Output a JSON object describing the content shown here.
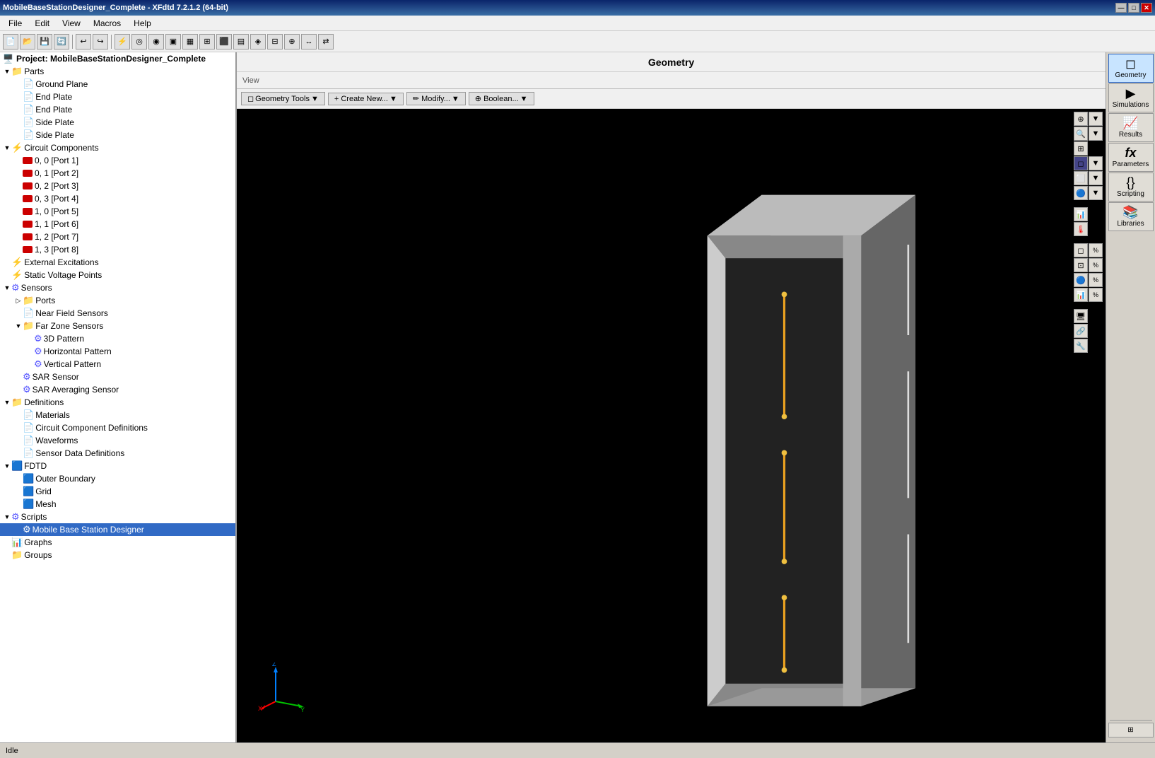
{
  "titlebar": {
    "title": "MobileBaseStationDesigner_Complete - XFdtd 7.2.1.2 (64-bit)",
    "controls": [
      "—",
      "□",
      "✕"
    ]
  },
  "menu": {
    "items": [
      "File",
      "Edit",
      "View",
      "Macros",
      "Help"
    ]
  },
  "geo_title": "Geometry",
  "view_label": "View",
  "toolbar_buttons": {
    "geo_tools_label": "Geometry Tools",
    "create_new_label": "+ Create New...",
    "modify_label": "✏ Modify...",
    "boolean_label": "⊕ Boolean..."
  },
  "tree": {
    "project_label": "Project: MobileBaseStationDesigner_Complete",
    "items": [
      {
        "id": "parts",
        "label": "Parts",
        "level": 0,
        "icon": "📁",
        "toggle": "▼",
        "type": "folder"
      },
      {
        "id": "ground-plane",
        "label": "Ground Plane",
        "level": 1,
        "icon": "📄",
        "toggle": " ",
        "type": "leaf"
      },
      {
        "id": "end-plate-1",
        "label": "End Plate",
        "level": 1,
        "icon": "📄",
        "toggle": " ",
        "type": "leaf"
      },
      {
        "id": "end-plate-2",
        "label": "End Plate",
        "level": 1,
        "icon": "📄",
        "toggle": " ",
        "type": "leaf"
      },
      {
        "id": "side-plate-1",
        "label": "Side Plate",
        "level": 1,
        "icon": "📄",
        "toggle": " ",
        "type": "leaf"
      },
      {
        "id": "side-plate-2",
        "label": "Side Plate",
        "level": 1,
        "icon": "📄",
        "toggle": " ",
        "type": "leaf"
      },
      {
        "id": "circuit-components",
        "label": "Circuit Components",
        "level": 0,
        "icon": "⚡",
        "toggle": "▼",
        "type": "folder"
      },
      {
        "id": "port-1",
        "label": "0, 0 [Port 1]",
        "level": 1,
        "icon": "🔴",
        "toggle": " ",
        "type": "leaf"
      },
      {
        "id": "port-2",
        "label": "0, 1 [Port 2]",
        "level": 1,
        "icon": "🔴",
        "toggle": " ",
        "type": "leaf"
      },
      {
        "id": "port-3",
        "label": "0, 2 [Port 3]",
        "level": 1,
        "icon": "🔴",
        "toggle": " ",
        "type": "leaf"
      },
      {
        "id": "port-4",
        "label": "0, 3 [Port 4]",
        "level": 1,
        "icon": "🔴",
        "toggle": " ",
        "type": "leaf"
      },
      {
        "id": "port-5",
        "label": "1, 0 [Port 5]",
        "level": 1,
        "icon": "🔴",
        "toggle": " ",
        "type": "leaf"
      },
      {
        "id": "port-6",
        "label": "1, 1 [Port 6]",
        "level": 1,
        "icon": "🔴",
        "toggle": " ",
        "type": "leaf"
      },
      {
        "id": "port-7",
        "label": "1, 2 [Port 7]",
        "level": 1,
        "icon": "🔴",
        "toggle": " ",
        "type": "leaf"
      },
      {
        "id": "port-8",
        "label": "1, 3 [Port 8]",
        "level": 1,
        "icon": "🔴",
        "toggle": " ",
        "type": "leaf"
      },
      {
        "id": "external-excitations",
        "label": "External Excitations",
        "level": 0,
        "icon": "⚡",
        "toggle": " ",
        "type": "leaf"
      },
      {
        "id": "static-voltage",
        "label": "Static Voltage Points",
        "level": 0,
        "icon": "🔵",
        "toggle": " ",
        "type": "leaf"
      },
      {
        "id": "sensors",
        "label": "Sensors",
        "level": 0,
        "icon": "🔵",
        "toggle": "▼",
        "type": "folder"
      },
      {
        "id": "ports",
        "label": "Ports",
        "level": 1,
        "icon": "📁",
        "toggle": "▷",
        "type": "folder"
      },
      {
        "id": "near-field",
        "label": "Near Field Sensors",
        "level": 1,
        "icon": "📄",
        "toggle": " ",
        "type": "leaf"
      },
      {
        "id": "far-zone",
        "label": "Far Zone Sensors",
        "level": 1,
        "icon": "📁",
        "toggle": "▼",
        "type": "folder"
      },
      {
        "id": "pattern-3d",
        "label": "3D Pattern",
        "level": 2,
        "icon": "🔵",
        "toggle": " ",
        "type": "leaf"
      },
      {
        "id": "horiz-pattern",
        "label": "Horizontal Pattern",
        "level": 2,
        "icon": "🔵",
        "toggle": " ",
        "type": "leaf"
      },
      {
        "id": "vert-pattern",
        "label": "Vertical Pattern",
        "level": 2,
        "icon": "🔵",
        "toggle": " ",
        "type": "leaf"
      },
      {
        "id": "sar-sensor",
        "label": "SAR Sensor",
        "level": 1,
        "icon": "🔵",
        "toggle": " ",
        "type": "leaf"
      },
      {
        "id": "sar-avg",
        "label": "SAR Averaging Sensor",
        "level": 1,
        "icon": "🔵",
        "toggle": " ",
        "type": "leaf"
      },
      {
        "id": "definitions",
        "label": "Definitions",
        "level": 0,
        "icon": "📁",
        "toggle": "▼",
        "type": "folder"
      },
      {
        "id": "materials",
        "label": "Materials",
        "level": 1,
        "icon": "📄",
        "toggle": " ",
        "type": "leaf"
      },
      {
        "id": "circuit-defs",
        "label": "Circuit Component Definitions",
        "level": 1,
        "icon": "📄",
        "toggle": " ",
        "type": "leaf"
      },
      {
        "id": "waveforms",
        "label": "Waveforms",
        "level": 1,
        "icon": "📄",
        "toggle": " ",
        "type": "leaf"
      },
      {
        "id": "sensor-data-defs",
        "label": "Sensor Data Definitions",
        "level": 1,
        "icon": "📄",
        "toggle": " ",
        "type": "leaf"
      },
      {
        "id": "fdtd",
        "label": "FDTD",
        "level": 0,
        "icon": "🟦",
        "toggle": "▼",
        "type": "folder"
      },
      {
        "id": "outer-boundary",
        "label": "Outer Boundary",
        "level": 1,
        "icon": "🟦",
        "toggle": " ",
        "type": "leaf"
      },
      {
        "id": "grid",
        "label": "Grid",
        "level": 1,
        "icon": "🟦",
        "toggle": " ",
        "type": "leaf"
      },
      {
        "id": "mesh",
        "label": "Mesh",
        "level": 1,
        "icon": "🟦",
        "toggle": " ",
        "type": "leaf"
      },
      {
        "id": "scripts",
        "label": "Scripts",
        "level": 0,
        "icon": "🔵",
        "toggle": "▼",
        "type": "folder"
      },
      {
        "id": "mobile-script",
        "label": "Mobile Base Station Designer",
        "level": 1,
        "icon": "⚙️",
        "toggle": " ",
        "type": "leaf",
        "selected": true
      },
      {
        "id": "graphs",
        "label": "Graphs",
        "level": 0,
        "icon": "📊",
        "toggle": " ",
        "type": "leaf"
      },
      {
        "id": "groups",
        "label": "Groups",
        "level": 0,
        "icon": "📁",
        "toggle": " ",
        "type": "leaf"
      }
    ]
  },
  "right_panel": {
    "buttons": [
      {
        "id": "geometry",
        "label": "Geometry",
        "icon": "◻",
        "active": true
      },
      {
        "id": "simulations",
        "label": "Simulations",
        "icon": "▶"
      },
      {
        "id": "results",
        "label": "Results",
        "icon": "📈"
      },
      {
        "id": "parameters",
        "label": "Parameters",
        "icon": "fx"
      },
      {
        "id": "scripting",
        "label": "Scripting",
        "icon": "{}"
      },
      {
        "id": "libraries",
        "label": "Libraries",
        "icon": "📚"
      }
    ]
  },
  "status": {
    "state": "Idle"
  }
}
